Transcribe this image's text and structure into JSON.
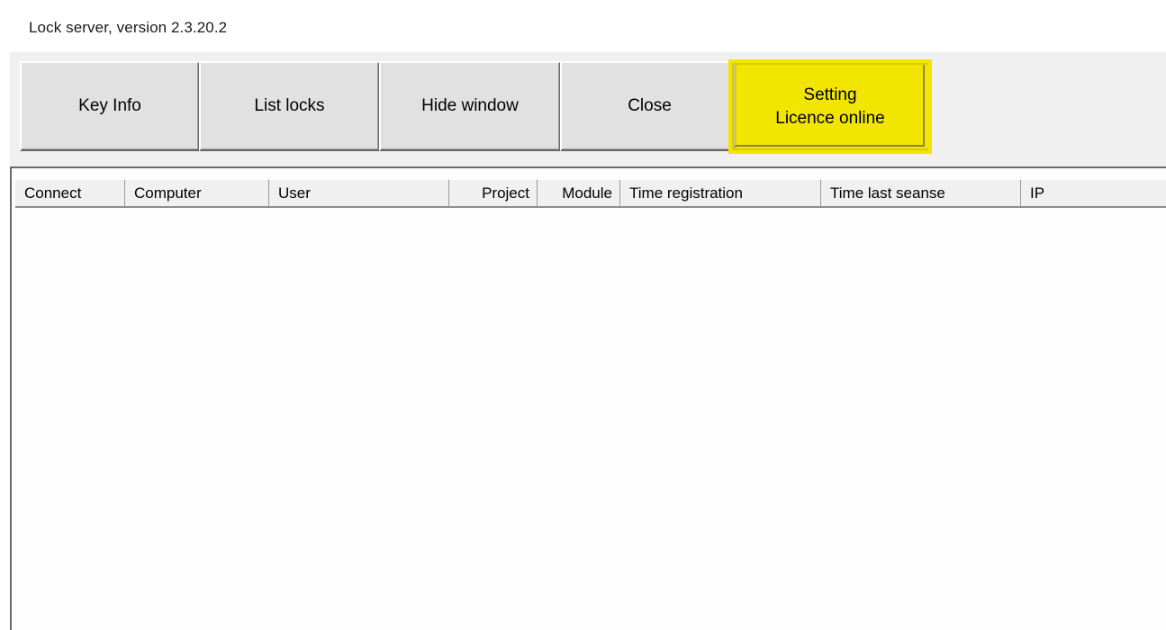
{
  "window": {
    "title": "Lock server, version 2.3.20.2"
  },
  "toolbar": {
    "buttons": [
      {
        "label": "Key Info"
      },
      {
        "label": "List locks"
      },
      {
        "label": "Hide window"
      },
      {
        "label": "Close"
      },
      {
        "label_line1": "Setting",
        "label_line2": "Licence online"
      }
    ],
    "highlight_color": "#f2e600"
  },
  "table": {
    "columns": [
      {
        "label": "Connect"
      },
      {
        "label": "Computer"
      },
      {
        "label": "User"
      },
      {
        "label": "Project"
      },
      {
        "label": "Module"
      },
      {
        "label": "Time registration"
      },
      {
        "label": "Time last seanse"
      },
      {
        "label": "IP"
      }
    ],
    "rows": []
  }
}
